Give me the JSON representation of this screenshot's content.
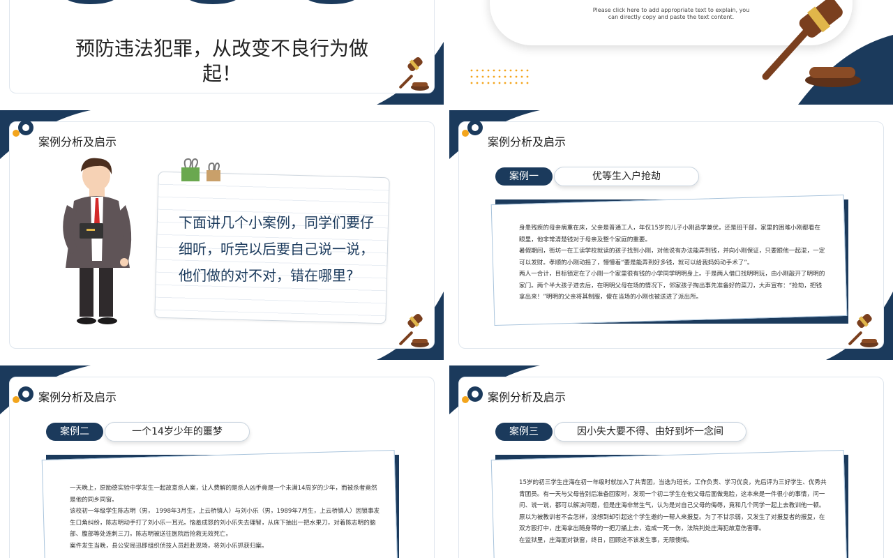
{
  "colors": {
    "navy": "#1b3a5c",
    "accent": "#f3a51d"
  },
  "slide1": {
    "heading": "预防违法犯罪，从改变不良行为做起！"
  },
  "slide2": {
    "note": "Please click here to add appropriate text to explain, you can directly copy and paste the text content."
  },
  "section_title": "案例分析及启示",
  "slide3": {
    "speech": "下面讲几个小案例，同学们要仔细听，听完以后要自己说一说，他们做的对不对，错在哪里?"
  },
  "slide4": {
    "tag": "案例一",
    "case_title": "优等生入户抢劫",
    "paragraphs": [
      "身患残疾的母亲病重在床，父亲是普通工人，年仅15岁的儿子小刚品学兼优，还是班干部。家里的困难小刚都看在眼里，他非常清楚钱对于母亲及整个家庭的重要。",
      "暑假期间，街坊一在工读学校就读的孩子找到小刚，对他说有办法能弄到钱，并向小刚保证，只要跟他一起混，一定可以发财。孝顺的小刚动摇了，懵懵着“要是能弄到好多钱，就可以给我妈妈动手术了”。",
      "两人一合计，目标锁定在了小刚一个家里很有钱的小学同学明明身上。于是两人借口找明明玩，由小刚敲开了明明的家门。两个半大孩子进去后，在明明父母在场的情况下，邻家孩子掏出事先准备好的菜刀，大声宣布：“抢劫，把钱拿出来！”明明的父亲将其制服，傻在当场的小刚也被送进了派出所。"
    ]
  },
  "slide5": {
    "tag": "案例二",
    "case_title": "一个14岁少年的噩梦",
    "paragraphs": [
      "一天晚上，原励德实验中学发生一起故意杀人案，让人费解的是杀人凶手竟是一个未满14周岁的少年，而被杀者竟然是他的同乡同窗。",
      "该校初一年级学生陈志明（男， 1998年3月生，上云桥镇人）与刘小乐（男，1989年7月生，上云桥镇人）因锁事发生口角纠纷，陈志明动手打了刘小乐一耳光。恼羞成怒的刘小乐失去理智，从床下抽出一把水果刀，对着陈志明的脑部、腹部等处连刺三刀。陈志明被送往医院后抢救无效死亡。",
      "案件发生当晚，县公安局迅即组织侦技人员赶赴现场，将刘小乐抓获归案。"
    ]
  },
  "slide6": {
    "tag": "案例三",
    "case_title": "因小失大要不得、由好到坏一念间",
    "paragraphs": [
      "15岁的初三学生庄海在初一年级时就加入了共青团，当选为班长，工作负责、学习优良，先后评为三好学生、优秀共青团员。有一天与父母告别后准备回家时，发现一个初二学生在他父母后面做鬼脸，这本来是一件很小的事情，问一问、说一说，都可以解决问题，但是庄海非常生气，认为是对自己父母的侮辱，竟和几个同学一起上去教训他一顿。原以为被教训者不会怎样，没想到却引起这个学生邀约一帮人来报复。为了不甘示弱，又发生了对报复者的报复，在双方殴打中，庄海拿出随身带的一把刀捅上去，造成一死一伤，法院判处庄海犯故意伤害罪。",
      "在监狱里，庄海面对铁窗，终日，回顾这不该发生事，无限懊悔。"
    ]
  }
}
